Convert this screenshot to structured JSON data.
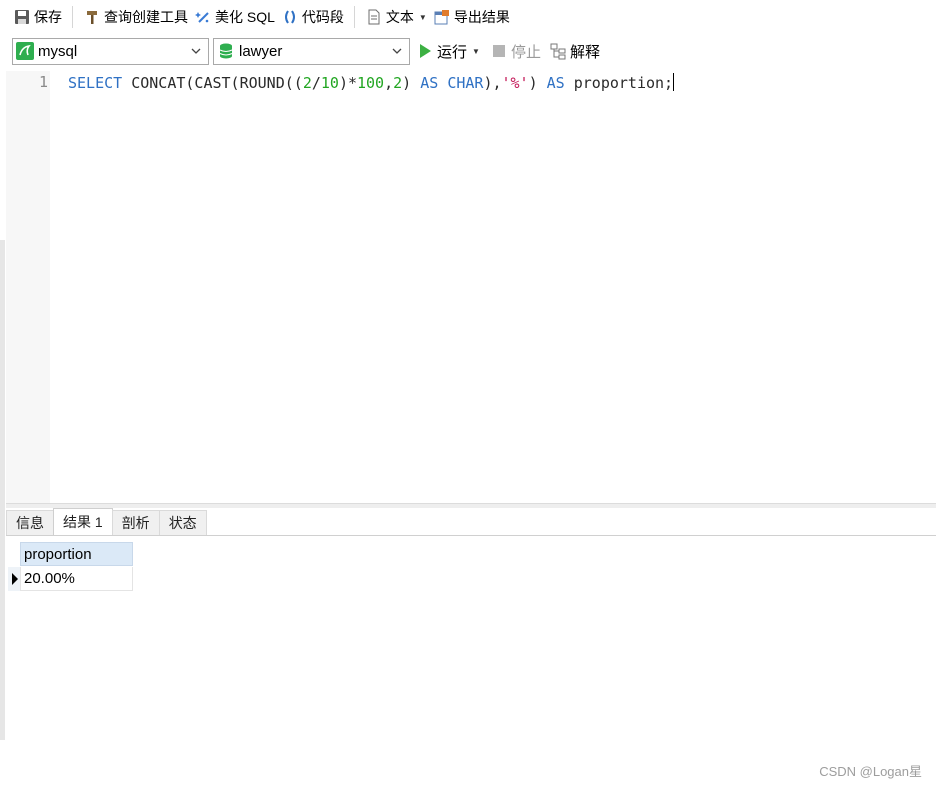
{
  "toolbar": {
    "save_label": "保存",
    "query_builder_label": "查询创建工具",
    "beautify_label": "美化 SQL",
    "snippet_label": "代码段",
    "text_label": "文本",
    "export_label": "导出结果"
  },
  "connection_bar": {
    "connection_value": "mysql",
    "database_value": "lawyer",
    "run_label": "运行",
    "stop_label": "停止",
    "explain_label": "解释"
  },
  "editor": {
    "line_number": "1",
    "code_tokens": [
      {
        "t": "SELECT",
        "c": "kw"
      },
      {
        "t": " CONCAT(CAST(ROUND((",
        "c": "plain"
      },
      {
        "t": "2",
        "c": "num"
      },
      {
        "t": "/",
        "c": "plain"
      },
      {
        "t": "10",
        "c": "num"
      },
      {
        "t": ")*",
        "c": "plain"
      },
      {
        "t": "100",
        "c": "num"
      },
      {
        "t": ",",
        "c": "plain"
      },
      {
        "t": "2",
        "c": "num"
      },
      {
        "t": ") ",
        "c": "plain"
      },
      {
        "t": "AS",
        "c": "kw"
      },
      {
        "t": " ",
        "c": "plain"
      },
      {
        "t": "CHAR",
        "c": "kw"
      },
      {
        "t": "),",
        "c": "plain"
      },
      {
        "t": "'%'",
        "c": "str"
      },
      {
        "t": ") ",
        "c": "plain"
      },
      {
        "t": "AS",
        "c": "kw"
      },
      {
        "t": " proportion;",
        "c": "plain"
      }
    ]
  },
  "result_tabs": [
    {
      "label": "信息",
      "active": false
    },
    {
      "label": "结果 1",
      "active": true
    },
    {
      "label": "剖析",
      "active": false
    },
    {
      "label": "状态",
      "active": false
    }
  ],
  "result_grid": {
    "columns": [
      "proportion"
    ],
    "rows": [
      [
        "20.00%"
      ]
    ]
  },
  "watermark": "CSDN @Logan星",
  "colors": {
    "keyword": "#2f71c4",
    "number": "#22a622",
    "string": "#c41a5a",
    "run_icon": "#3cb043",
    "grid_header": "#dbe9f7"
  }
}
